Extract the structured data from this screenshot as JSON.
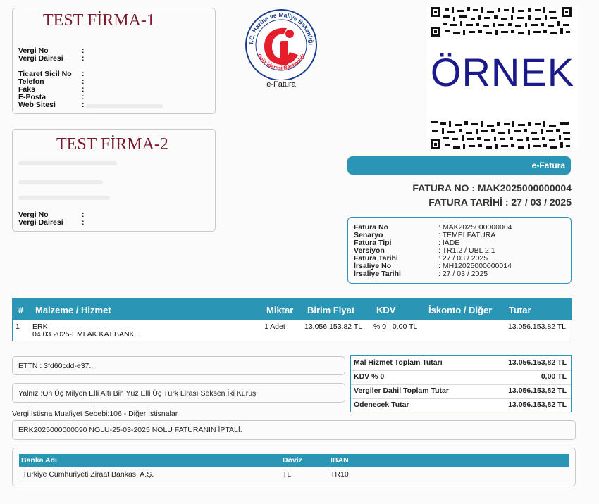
{
  "seller": {
    "name": "TEST FİRMA-1",
    "fields": [
      {
        "label": "Vergi No",
        "value": ""
      },
      {
        "label": "Vergi Dairesi",
        "value": ""
      },
      {
        "label": "Ticaret Sicil No",
        "value": ""
      },
      {
        "label": "Telefon",
        "value": ""
      },
      {
        "label": "Faks",
        "value": ""
      },
      {
        "label": "E-Posta",
        "value": ""
      },
      {
        "label": "Web Sitesi",
        "value": ""
      }
    ]
  },
  "buyer": {
    "name": "TEST FİRMA-2",
    "fields": [
      {
        "label": "Vergi No",
        "value": ""
      },
      {
        "label": "Vergi Dairesi",
        "value": ""
      }
    ]
  },
  "logo": {
    "ring_text": "T.C. Hazine ve Maliye Bakanlığı",
    "bottom_text": "Gelir İdaresi Başkanlığı",
    "caption": "e-Fatura"
  },
  "watermark": "ÖRNEK",
  "doc_type_label": "e-Fatura",
  "invoice_no_line": "FATURA NO : MAK2025000000004",
  "invoice_date_line": "FATURA TARİHİ : 27 / 03 / 2025",
  "info": [
    {
      "label": "Fatura No",
      "value": ": MAK2025000000004"
    },
    {
      "label": "Senaryo",
      "value": ": TEMELFATURA"
    },
    {
      "label": "Fatura Tipi",
      "value": ": IADE"
    },
    {
      "label": "Versiyon",
      "value": ": TR1.2 / UBL 2.1"
    },
    {
      "label": "Fatura Tarihi",
      "value": ": 27 / 03 / 2025"
    },
    {
      "label": "İrsaliye No",
      "value": ": MH12025000000014"
    },
    {
      "label": "İrsaliye Tarihi",
      "value": ": 27 / 03 / 2025"
    }
  ],
  "items_table": {
    "headers": [
      "#",
      "Malzeme / Hizmet",
      "Miktar",
      "Birim Fiyat",
      "KDV",
      "İskonto / Diğer",
      "Tutar"
    ],
    "rows": [
      {
        "no": "1",
        "name": "ERK",
        "desc": "04.03.2025-EMLAK KAT.BANK..",
        "qty": "1 Adet",
        "unit_price": "13.056.153,82 TL",
        "kdv": "% 0   0,00 TL",
        "discount": "",
        "total": "13.056.153,82 TL"
      }
    ]
  },
  "ettn": "ETTN : 3fd60cdd-e37..",
  "amount_in_words": "Yalnız :On Üç Milyon Elli Altı Bin Yüz Elli Üç Türk Lirası Seksen İki Kuruş",
  "totals": [
    {
      "label": "Mal Hizmet Toplam Tutarı",
      "value": "13.056.153,82 TL"
    },
    {
      "label": "KDV % 0",
      "value": "0,00 TL"
    },
    {
      "label": "Vergiler Dahil Toplam Tutar",
      "value": "13.056.153,82 TL"
    },
    {
      "label": "Ödenecek Tutar",
      "value": "13.056.153,82 TL"
    }
  ],
  "exemption_reason": "Vergi İstisna Muafiyet Sebebi:106 - Diğer İstisnalar",
  "note": "ERK2025000000090 NOLU-25-03-2025 NOLU FATURANIN İPTALİ.",
  "bank_table": {
    "headers": [
      "Banka Adı",
      "Döviz",
      "IBAN"
    ],
    "rows": [
      {
        "bank": "Türkiye Cumhuriyeti Ziraat Bankası A.Ş.",
        "currency": "TL",
        "iban": "TR10"
      }
    ]
  },
  "colors": {
    "accent": "#2a95b4",
    "firm_name": "#7c1a2c",
    "watermark": "#1a1a8c",
    "logo_red": "#e41e2b",
    "logo_blue": "#1a3d8f"
  }
}
